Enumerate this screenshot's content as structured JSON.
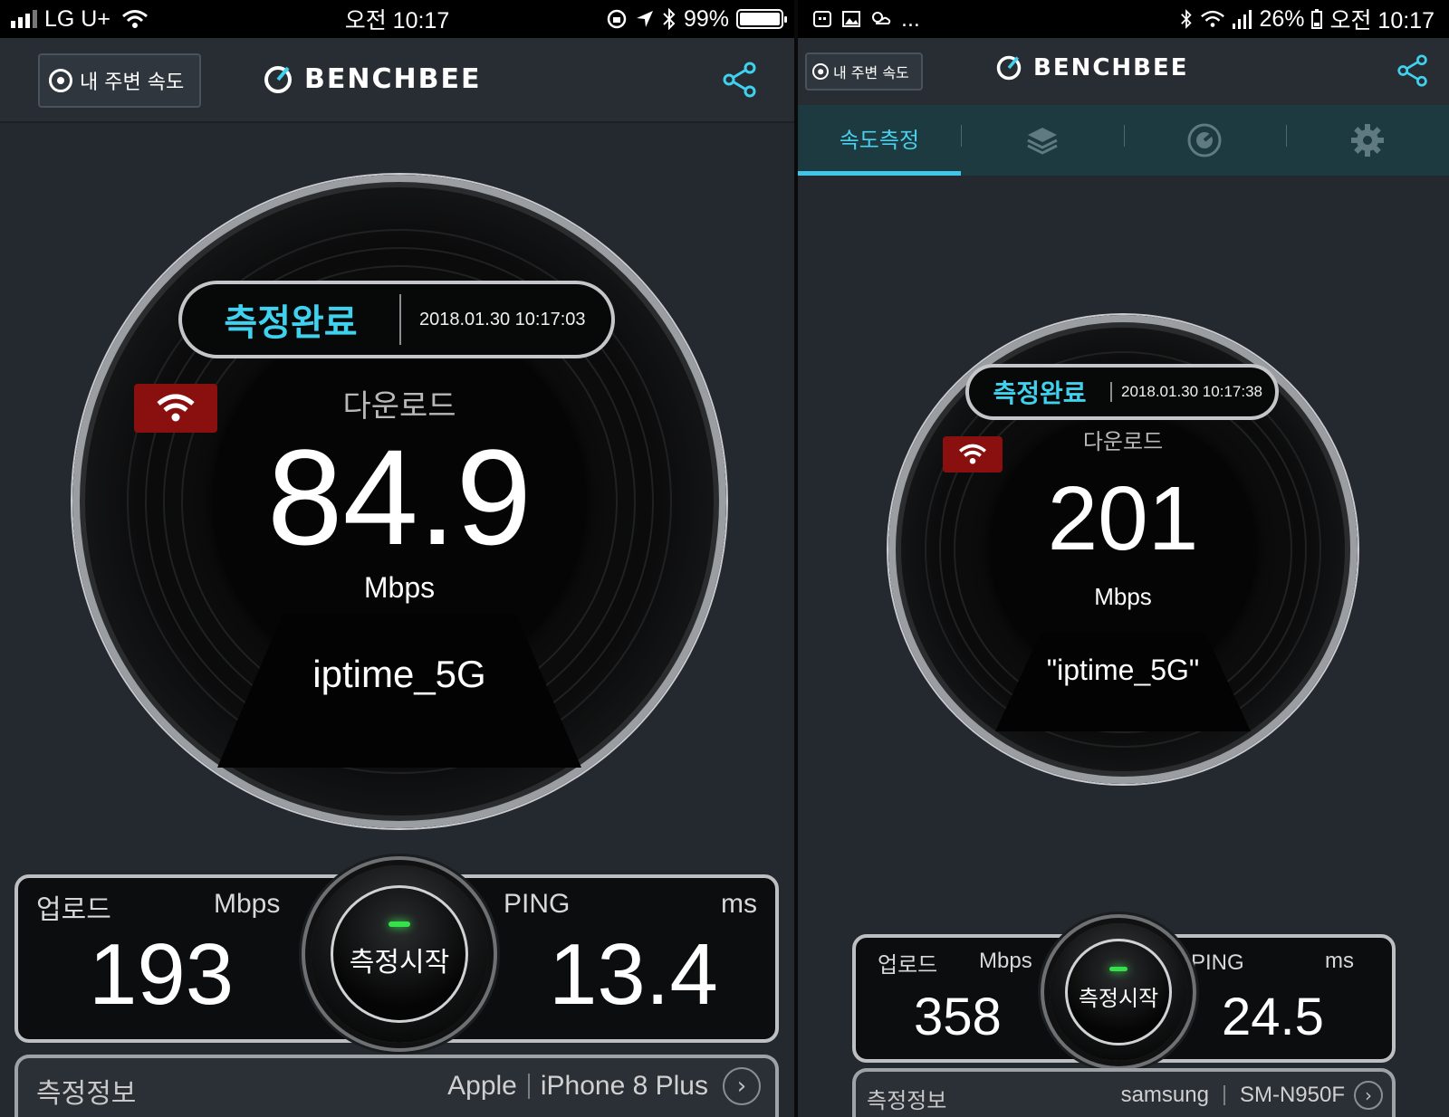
{
  "left": {
    "status": {
      "carrier": "LG U+",
      "time": "오전 10:17",
      "battery": "99%"
    },
    "header": {
      "near_label": "내 주변 속도",
      "logo": "BENCHBEE"
    },
    "result": {
      "badge": "측정완료",
      "datetime": "2018.01.30 10:17:03",
      "metric_label": "다운로드",
      "value": "84.9",
      "unit": "Mbps",
      "network": "iptime_5G"
    },
    "stats": {
      "upload_label": "업로드",
      "upload_unit": "Mbps",
      "upload_value": "193",
      "ping_label": "PING",
      "ping_unit": "ms",
      "ping_value": "13.4",
      "start_label": "측정시작"
    },
    "info": {
      "label": "측정정보",
      "maker": "Apple",
      "model": "iPhone 8 Plus",
      "chevron": "›"
    }
  },
  "right": {
    "status": {
      "more": "...",
      "battery": "26%",
      "time": "오전 10:17"
    },
    "header": {
      "near_label": "내 주변 속도",
      "logo": "BENCHBEE"
    },
    "tabs": [
      {
        "label": "속도측정",
        "icon": "speed-tab"
      },
      {
        "label": "",
        "icon": "layers-icon"
      },
      {
        "label": "",
        "icon": "gauge-icon"
      },
      {
        "label": "",
        "icon": "gear-icon"
      }
    ],
    "result": {
      "badge": "측정완료",
      "datetime": "2018.01.30 10:17:38",
      "metric_label": "다운로드",
      "value": "201",
      "unit": "Mbps",
      "network": "\"iptime_5G\""
    },
    "stats": {
      "upload_label": "업로드",
      "upload_unit": "Mbps",
      "upload_value": "358",
      "ping_label": "PING",
      "ping_unit": "ms",
      "ping_value": "24.5",
      "start_label": "측정시작"
    },
    "info": {
      "label": "측정정보",
      "maker": "samsung",
      "model": "SM-N950F",
      "chevron": "›"
    }
  },
  "colors": {
    "accent": "#3fd1ee",
    "wifi_badge": "#8a0f0f",
    "led": "#36e04a",
    "background": "#24292f"
  }
}
